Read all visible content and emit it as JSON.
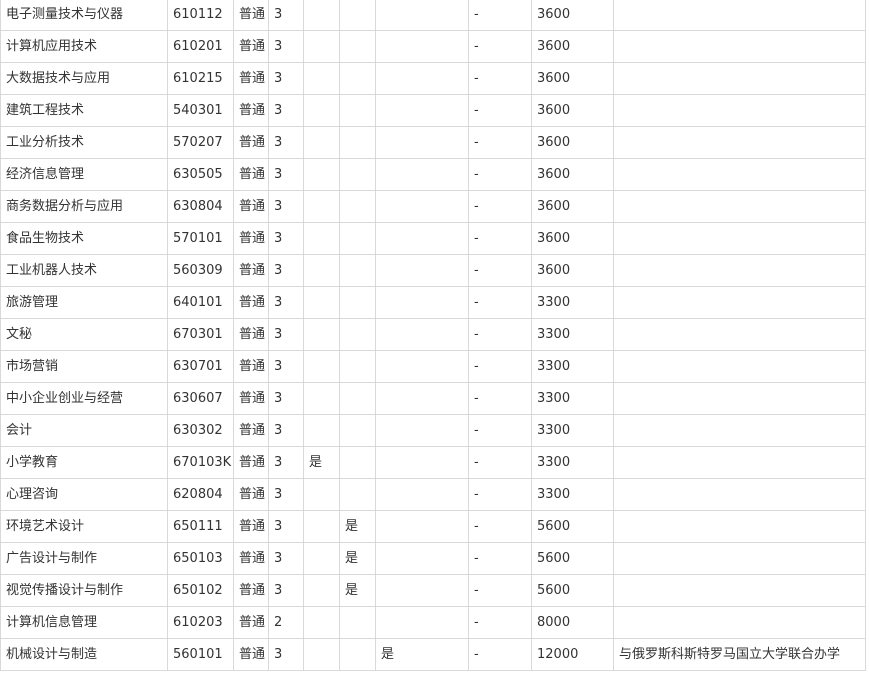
{
  "table": {
    "rows": [
      {
        "name": "电子测量技术与仪器",
        "code": "610112",
        "type": "普通",
        "years": "3",
        "f1": "",
        "f2": "",
        "f3": "",
        "dash": "-",
        "fee": "3600",
        "note": ""
      },
      {
        "name": "计算机应用技术",
        "code": "610201",
        "type": "普通",
        "years": "3",
        "f1": "",
        "f2": "",
        "f3": "",
        "dash": "-",
        "fee": "3600",
        "note": ""
      },
      {
        "name": "大数据技术与应用",
        "code": "610215",
        "type": "普通",
        "years": "3",
        "f1": "",
        "f2": "",
        "f3": "",
        "dash": "-",
        "fee": "3600",
        "note": ""
      },
      {
        "name": "建筑工程技术",
        "code": "540301",
        "type": "普通",
        "years": "3",
        "f1": "",
        "f2": "",
        "f3": "",
        "dash": "-",
        "fee": "3600",
        "note": ""
      },
      {
        "name": "工业分析技术",
        "code": "570207",
        "type": "普通",
        "years": "3",
        "f1": "",
        "f2": "",
        "f3": "",
        "dash": "-",
        "fee": "3600",
        "note": ""
      },
      {
        "name": "经济信息管理",
        "code": "630505",
        "type": "普通",
        "years": "3",
        "f1": "",
        "f2": "",
        "f3": "",
        "dash": "-",
        "fee": "3600",
        "note": ""
      },
      {
        "name": "商务数据分析与应用",
        "code": "630804",
        "type": "普通",
        "years": "3",
        "f1": "",
        "f2": "",
        "f3": "",
        "dash": "-",
        "fee": "3600",
        "note": ""
      },
      {
        "name": "食品生物技术",
        "code": "570101",
        "type": "普通",
        "years": "3",
        "f1": "",
        "f2": "",
        "f3": "",
        "dash": "-",
        "fee": "3600",
        "note": ""
      },
      {
        "name": "工业机器人技术",
        "code": "560309",
        "type": "普通",
        "years": "3",
        "f1": "",
        "f2": "",
        "f3": "",
        "dash": "-",
        "fee": "3600",
        "note": ""
      },
      {
        "name": "旅游管理",
        "code": "640101",
        "type": "普通",
        "years": "3",
        "f1": "",
        "f2": "",
        "f3": "",
        "dash": "-",
        "fee": "3300",
        "note": ""
      },
      {
        "name": "文秘",
        "code": "670301",
        "type": "普通",
        "years": "3",
        "f1": "",
        "f2": "",
        "f3": "",
        "dash": "-",
        "fee": "3300",
        "note": ""
      },
      {
        "name": "市场营销",
        "code": "630701",
        "type": "普通",
        "years": "3",
        "f1": "",
        "f2": "",
        "f3": "",
        "dash": "-",
        "fee": "3300",
        "note": ""
      },
      {
        "name": "中小企业创业与经营",
        "code": "630607",
        "type": "普通",
        "years": "3",
        "f1": "",
        "f2": "",
        "f3": "",
        "dash": "-",
        "fee": "3300",
        "note": ""
      },
      {
        "name": "会计",
        "code": "630302",
        "type": "普通",
        "years": "3",
        "f1": "",
        "f2": "",
        "f3": "",
        "dash": "-",
        "fee": "3300",
        "note": ""
      },
      {
        "name": "小学教育",
        "code": "670103K",
        "type": "普通",
        "years": "3",
        "f1": "是",
        "f2": "",
        "f3": "",
        "dash": "-",
        "fee": "3300",
        "note": ""
      },
      {
        "name": "心理咨询",
        "code": "620804",
        "type": "普通",
        "years": "3",
        "f1": "",
        "f2": "",
        "f3": "",
        "dash": "-",
        "fee": "3300",
        "note": ""
      },
      {
        "name": "环境艺术设计",
        "code": "650111",
        "type": "普通",
        "years": "3",
        "f1": "",
        "f2": "是",
        "f3": "",
        "dash": "-",
        "fee": "5600",
        "note": ""
      },
      {
        "name": "广告设计与制作",
        "code": "650103",
        "type": "普通",
        "years": "3",
        "f1": "",
        "f2": "是",
        "f3": "",
        "dash": "-",
        "fee": "5600",
        "note": ""
      },
      {
        "name": "视觉传播设计与制作",
        "code": "650102",
        "type": "普通",
        "years": "3",
        "f1": "",
        "f2": "是",
        "f3": "",
        "dash": "-",
        "fee": "5600",
        "note": ""
      },
      {
        "name": "计算机信息管理",
        "code": "610203",
        "type": "普通",
        "years": "2",
        "f1": "",
        "f2": "",
        "f3": "",
        "dash": "-",
        "fee": "8000",
        "note": ""
      },
      {
        "name": "机械设计与制造",
        "code": "560101",
        "type": "普通",
        "years": "3",
        "f1": "",
        "f2": "",
        "f3": "是",
        "dash": "-",
        "fee": "12000",
        "note": "与俄罗斯科斯特罗马国立大学联合办学"
      }
    ]
  }
}
